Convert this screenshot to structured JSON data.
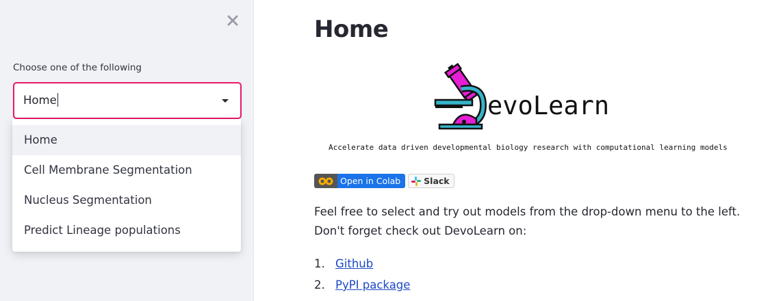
{
  "sidebar": {
    "close_icon": "close-icon",
    "select_label": "Choose one of the following",
    "select_value": "Home",
    "accent_color": "#e8176b",
    "options": [
      {
        "label": "Home"
      },
      {
        "label": "Cell Membrane Segmentation"
      },
      {
        "label": "Nucleus Segmentation"
      },
      {
        "label": "Predict Lineage populations"
      }
    ]
  },
  "main": {
    "title": "Home",
    "logo_text": "evoLearn",
    "tagline": "Accelerate data driven developmental biology research with computational learning models",
    "badges": {
      "colab_label": "Open in Colab",
      "slack_label": "Slack"
    },
    "paragraph": {
      "line1": "Feel free to select and try out models from the drop-down menu to the left.",
      "line2": "Don't forget check out DevoLearn on:"
    },
    "links": [
      {
        "num": "1.",
        "label": "Github"
      },
      {
        "num": "2.",
        "label": "PyPI package"
      }
    ]
  }
}
